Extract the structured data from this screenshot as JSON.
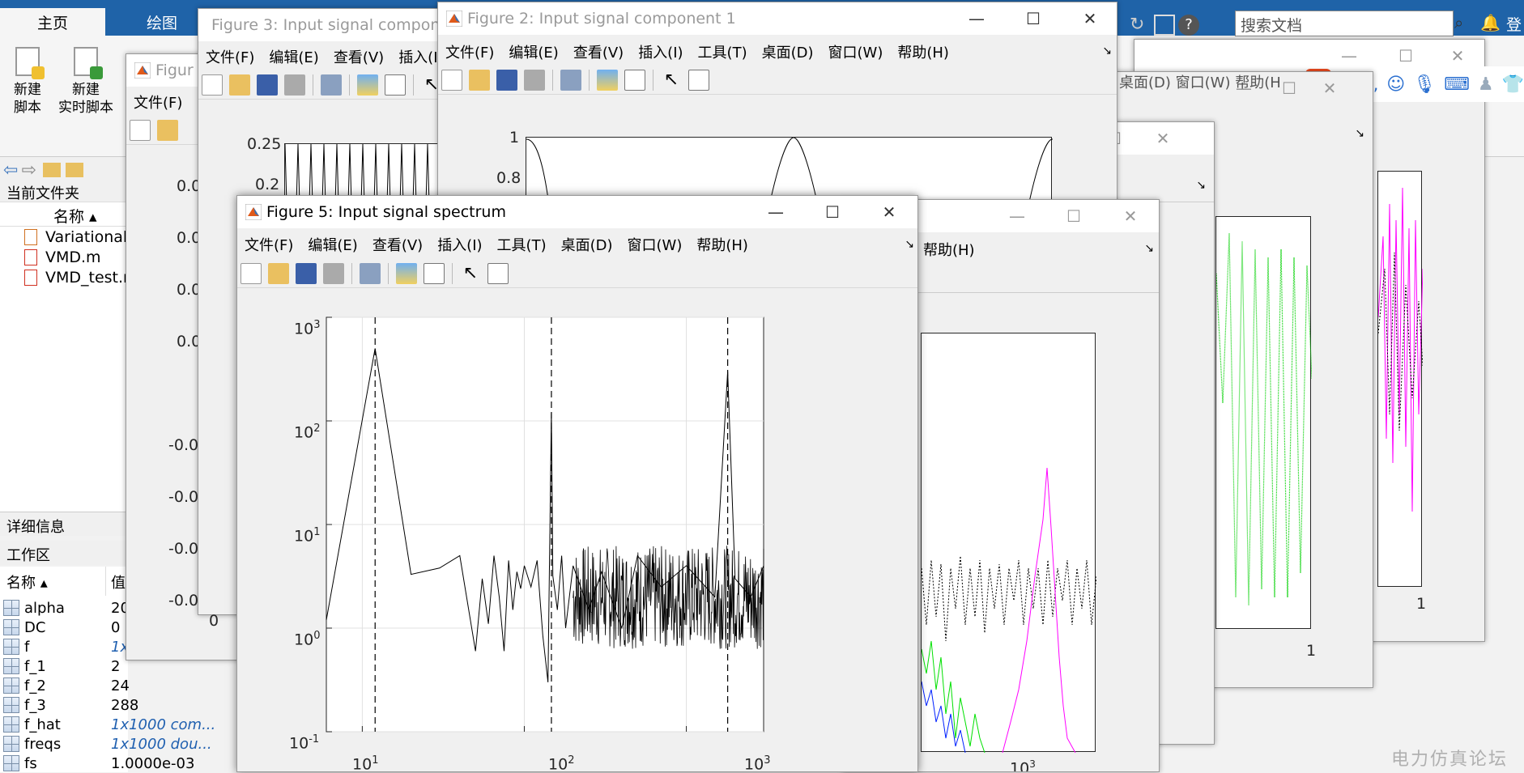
{
  "ribbon": {
    "tabs": [
      "主页",
      "绘图"
    ],
    "new_script": "新建\n脚本",
    "new_script_l1": "新建",
    "new_script_l2": "脚本",
    "new_live_l1": "新建",
    "new_live_l2": "实时脚本",
    "search_placeholder": "搜索文档",
    "login_fragment": "登"
  },
  "left_panel": {
    "current_folder_label": "当前文件夹",
    "name_header": "名称",
    "files": [
      "Variational",
      "VMD.m",
      "VMD_test.m"
    ],
    "details_label": "详细信息",
    "workspace_label": "工作区",
    "ws_name_header": "名称",
    "ws_value_header": "值",
    "variables": [
      {
        "name": "alpha",
        "value": "20"
      },
      {
        "name": "DC",
        "value": "0"
      },
      {
        "name": "f",
        "value": "1x"
      },
      {
        "name": "f_1",
        "value": "2"
      },
      {
        "name": "f_2",
        "value": "24"
      },
      {
        "name": "f_3",
        "value": "288"
      },
      {
        "name": "f_hat",
        "value": "1x1000 com..."
      },
      {
        "name": "freqs",
        "value": "1x1000 dou..."
      },
      {
        "name": "fs",
        "value": "1.0000e-03"
      }
    ]
  },
  "ime": {
    "lang": "中",
    "punct": "°,"
  },
  "menu_labels": [
    "文件(F)",
    "编辑(E)",
    "查看(V)",
    "插入(I)",
    "工具(T)",
    "桌面(D)",
    "窗口(W)",
    "帮助(H)"
  ],
  "fig3": {
    "title": "Figure 3: Input signal component",
    "menu": [
      "文件(F)",
      "编辑(E)",
      "查看(V)",
      "插入(I)"
    ],
    "yticks": [
      "0.25",
      "0.2"
    ]
  },
  "fig_hidden": {
    "title": "Figur",
    "menu_first": "文件(F)",
    "yticks": [
      "0.0",
      "0.0",
      "0.0",
      "0.0",
      "-0.0",
      "-0.0",
      "-0.0",
      "-0.0"
    ],
    "xtick0": "0"
  },
  "fig2": {
    "title": "Figure 2: Input signal component 1",
    "menu": [
      "文件(F)",
      "编辑(E)",
      "查看(V)",
      "插入(I)",
      "工具(T)",
      "桌面(D)",
      "窗口(W)",
      "帮助(H)"
    ],
    "yticks": [
      "1",
      "0.8"
    ]
  },
  "back_figs": {
    "help_label": "帮助(H)",
    "partial_menu": "桌面(D)  窗口(W)  帮助(H)",
    "xtick_one": "1",
    "xtick_1e3_base": "10",
    "xtick_1e3_exp": "3"
  },
  "fig5": {
    "title": "Figure 5: Input signal spectrum",
    "menu": [
      "文件(F)",
      "编辑(E)",
      "查看(V)",
      "插入(I)",
      "工具(T)",
      "桌面(D)",
      "窗口(W)",
      "帮助(H)"
    ],
    "yticks": [
      {
        "base": "10",
        "exp": "3"
      },
      {
        "base": "10",
        "exp": "2"
      },
      {
        "base": "10",
        "exp": "1"
      },
      {
        "base": "10",
        "exp": "0"
      },
      {
        "base": "10",
        "exp": "-1"
      }
    ],
    "xticks": [
      {
        "base": "10",
        "exp": "1"
      },
      {
        "base": "10",
        "exp": "2"
      },
      {
        "base": "10",
        "exp": "3"
      }
    ]
  },
  "chart_data": {
    "type": "line",
    "scale": "log-log",
    "xlim": [
      6,
      3000
    ],
    "ylim": [
      0.1,
      1000
    ],
    "grid": true,
    "vlines_dashed": [
      12,
      147,
      1800
    ],
    "series": [
      {
        "x": [
          6,
          12,
          20,
          30,
          40,
          50,
          55,
          60,
          65,
          70,
          75,
          80,
          85,
          90,
          95,
          100,
          110,
          120,
          130,
          140,
          147,
          150,
          160,
          170,
          180,
          200,
          250,
          300,
          400,
          500,
          700,
          1000,
          1500,
          1800,
          2000,
          2500,
          3000
        ],
        "y": [
          1.2,
          500,
          3.3,
          3.8,
          5.0,
          0.6,
          3.0,
          1.1,
          5.0,
          2.0,
          0.6,
          4.5,
          1.5,
          3.5,
          2.4,
          4.0,
          2.5,
          4.5,
          0.85,
          0.3,
          120,
          3.2,
          1.5,
          5.0,
          1.0,
          4.0,
          1.5,
          3.5,
          1.0,
          5.0,
          2.5,
          4.0,
          2.0,
          300,
          3.0,
          2.0,
          4.0
        ]
      }
    ]
  },
  "watermark": "电力仿真论坛"
}
